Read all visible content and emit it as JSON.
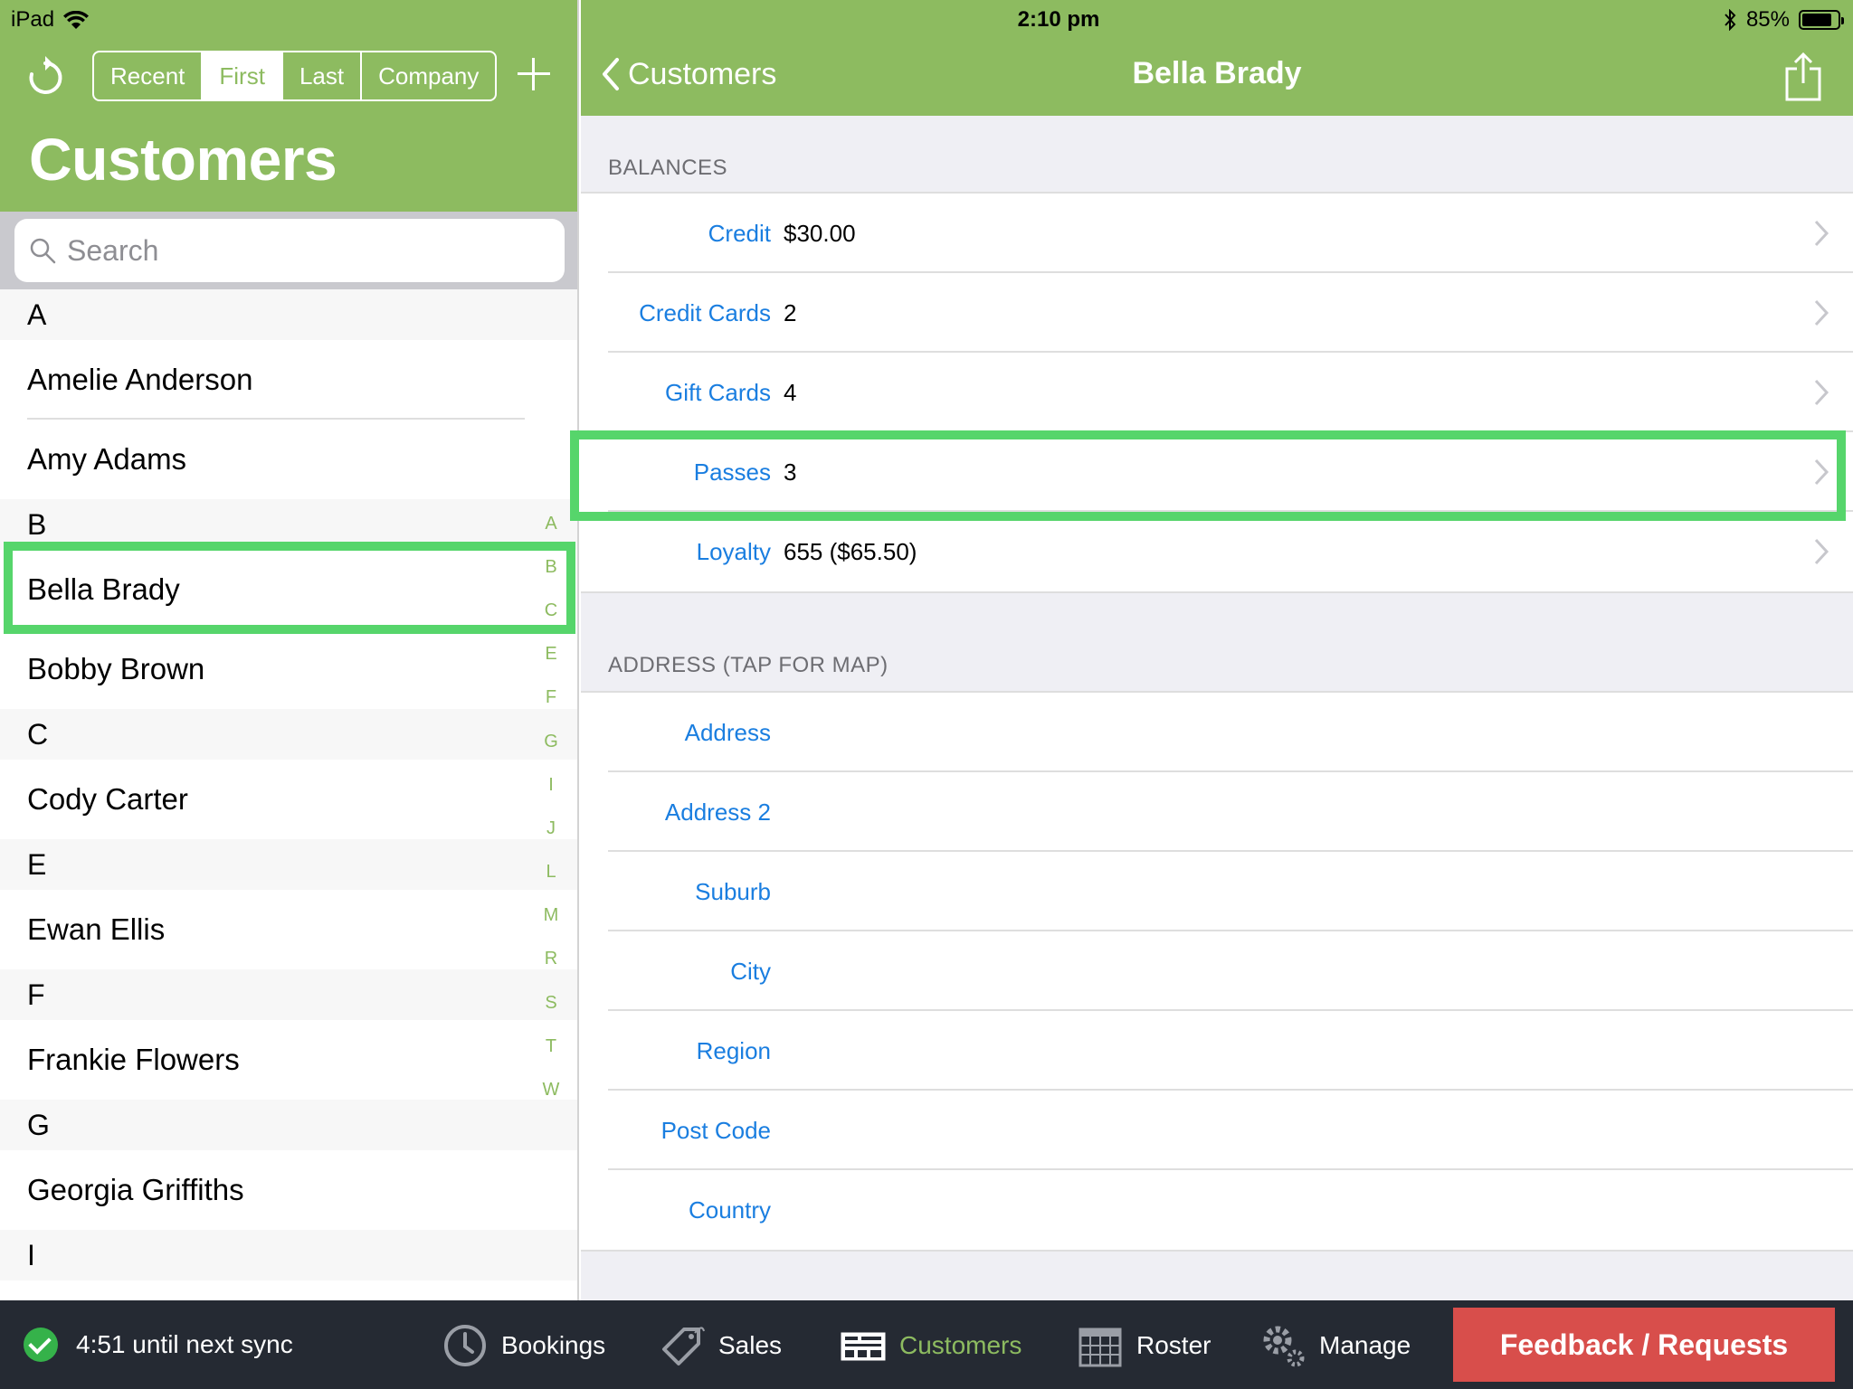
{
  "status_bar": {
    "device": "iPad",
    "time": "2:10 pm",
    "battery": "85%",
    "battery_level": 0.85
  },
  "left_pane": {
    "sort_segments": [
      {
        "label": "Recent",
        "active": false
      },
      {
        "label": "First",
        "active": true
      },
      {
        "label": "Last",
        "active": false
      },
      {
        "label": "Company",
        "active": false
      }
    ],
    "title": "Customers",
    "search_placeholder": "Search",
    "sections": [
      {
        "letter": "A",
        "customers": [
          "Amelie Anderson",
          "Amy Adams"
        ]
      },
      {
        "letter": "B",
        "customers": [
          "Bella Brady",
          "Bobby Brown"
        ]
      },
      {
        "letter": "C",
        "customers": [
          "Cody  Carter"
        ]
      },
      {
        "letter": "E",
        "customers": [
          "Ewan Ellis"
        ]
      },
      {
        "letter": "F",
        "customers": [
          "Frankie Flowers"
        ]
      },
      {
        "letter": "G",
        "customers": [
          "Georgia Griffiths"
        ]
      },
      {
        "letter": "I",
        "customers": []
      }
    ],
    "index_letters": [
      "A",
      "B",
      "C",
      "E",
      "F",
      "G",
      "I",
      "J",
      "L",
      "M",
      "R",
      "S",
      "T",
      "W"
    ],
    "highlighted_customer": "Bella Brady"
  },
  "right_pane": {
    "back_label": "Customers",
    "title": "Bella Brady",
    "balances_header": "BALANCES",
    "balances": [
      {
        "label": "Credit",
        "value": "$30.00"
      },
      {
        "label": "Credit Cards",
        "value": "2"
      },
      {
        "label": "Gift Cards",
        "value": "4"
      },
      {
        "label": "Passes",
        "value": "3"
      },
      {
        "label": "Loyalty",
        "value": "655 ($65.50)"
      }
    ],
    "address_header": "ADDRESS (TAP FOR MAP)",
    "address_fields": [
      {
        "label": "Address",
        "value": ""
      },
      {
        "label": "Address 2",
        "value": ""
      },
      {
        "label": "Suburb",
        "value": ""
      },
      {
        "label": "City",
        "value": ""
      },
      {
        "label": "Region",
        "value": ""
      },
      {
        "label": "Post Code",
        "value": ""
      },
      {
        "label": "Country",
        "value": ""
      }
    ],
    "highlighted_row": "Passes"
  },
  "bottom_bar": {
    "sync_text": "4:51 until next sync",
    "tabs": [
      {
        "label": "Bookings",
        "icon": "clock-icon",
        "active": false
      },
      {
        "label": "Sales",
        "icon": "price-tag-icon",
        "active": false
      },
      {
        "label": "Customers",
        "icon": "customers-cards-icon",
        "active": true
      },
      {
        "label": "Roster",
        "icon": "calendar-icon",
        "active": false
      },
      {
        "label": "Manage",
        "icon": "gears-icon",
        "active": false
      }
    ],
    "feedback_label": "Feedback / Requests"
  },
  "colors": {
    "brand_green": "#8dbb60",
    "link_blue": "#1a7ee0",
    "highlight_green": "#56d56b",
    "feedback_red": "#d84e4b",
    "bar_dark": "#252a33"
  }
}
